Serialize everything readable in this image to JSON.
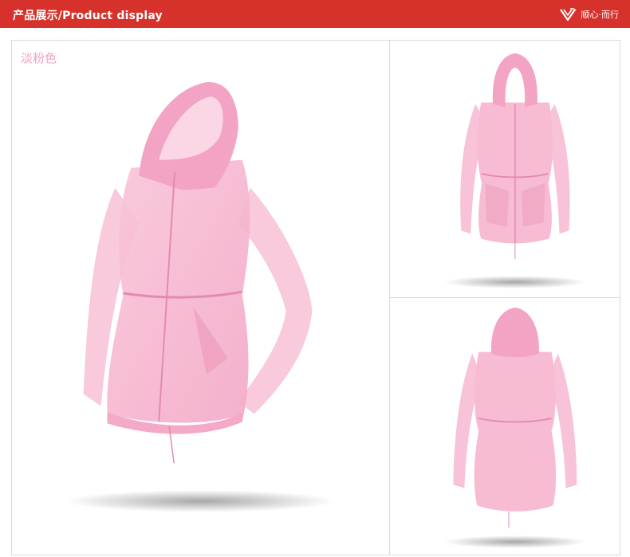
{
  "header": {
    "title": "产品展示/Product display",
    "brand_text": "顺心·而行",
    "logo_icon": "v-shield-logo-icon",
    "background": "#d6322b"
  },
  "main_photo": {
    "color_label": "淡粉色",
    "label_color": "#f1a1c4",
    "subject": "jacket-angled-view-image"
  },
  "front_photo": {
    "subject": "jacket-front-view-image"
  },
  "back_photo": {
    "subject": "jacket-back-view-image"
  },
  "product_colors": {
    "jacket": "#f6b6cf",
    "jacket_dark": "#ee9dbd",
    "shadow": "#8a8a8a"
  }
}
